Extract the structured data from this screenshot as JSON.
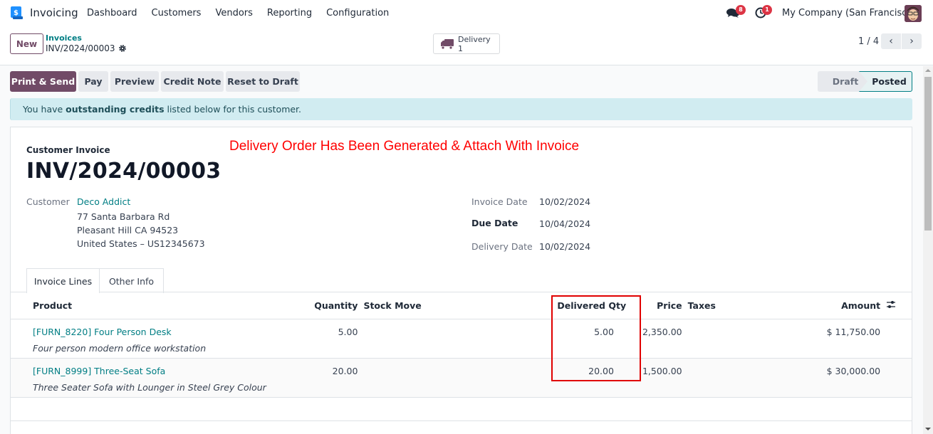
{
  "navbar": {
    "app_name": "Invoicing",
    "menu": [
      "Dashboard",
      "Customers",
      "Vendors",
      "Reporting",
      "Configuration"
    ],
    "messages_badge": "8",
    "activities_badge": "1",
    "company": "My Company (San Francisco)",
    "brand_color": "#714b67",
    "badge_color": "#dc3545"
  },
  "control_panel": {
    "new_label": "New",
    "breadcrumb_parent": "Invoices",
    "breadcrumb_current": "INV/2024/00003",
    "smart_button": {
      "label": "Delivery",
      "value": "1",
      "icon": "truck-icon"
    },
    "pager": {
      "value": "1 / 4"
    }
  },
  "actions": {
    "print_send": "Print & Send",
    "pay": "Pay",
    "preview": "Preview",
    "credit_note": "Credit Note",
    "reset_to_draft": "Reset to Draft"
  },
  "status": {
    "stages": [
      "Draft",
      "Posted"
    ],
    "current": "Posted"
  },
  "alert": {
    "prefix": "You have ",
    "bold": "outstanding credits",
    "suffix": " listed below for this customer."
  },
  "sheet": {
    "doc_type": "Customer Invoice",
    "doc_name": "INV/2024/00003",
    "annotation": "Delivery Order Has Been Generated & Attach With Invoice",
    "customer_label": "Customer",
    "customer_name": "Deco Addict",
    "address": [
      "77 Santa Barbara Rd",
      "Pleasant Hill CA 94523",
      "United States – US12345673"
    ],
    "invoice_date_label": "Invoice Date",
    "invoice_date": "10/02/2024",
    "due_date_label": "Due Date",
    "due_date": "10/04/2024",
    "delivery_date_label": "Delivery Date",
    "delivery_date": "10/02/2024",
    "tabs": [
      "Invoice Lines",
      "Other Info"
    ],
    "active_tab": "Invoice Lines"
  },
  "lines": {
    "headers": {
      "product": "Product",
      "quantity": "Quantity",
      "stock_move": "Stock Move",
      "delivered_qty": "Delivered Qty",
      "price": "Price",
      "taxes": "Taxes",
      "amount": "Amount"
    },
    "rows": [
      {
        "product": "[FURN_8220] Four Person Desk",
        "description": "Four person modern office workstation",
        "quantity": "5.00",
        "stock_move": "",
        "delivered_qty": "5.00",
        "price": "2,350.00",
        "taxes": "",
        "amount": "$ 11,750.00"
      },
      {
        "product": "[FURN_8999] Three-Seat Sofa",
        "description": "Three Seater Sofa with Lounger in Steel Grey Colour",
        "quantity": "20.00",
        "stock_move": "",
        "delivered_qty": "20.00",
        "price": "1,500.00",
        "taxes": "",
        "amount": "$ 30,000.00"
      }
    ]
  }
}
